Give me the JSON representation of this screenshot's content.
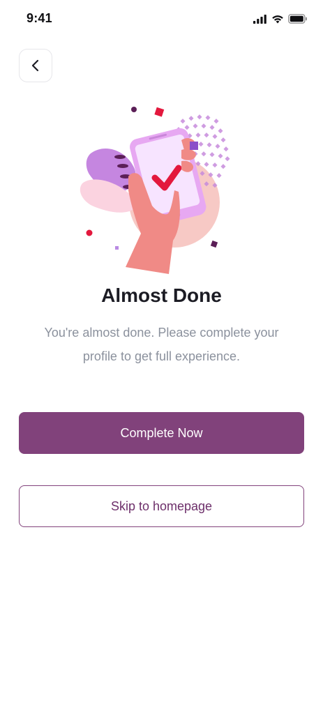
{
  "status_bar": {
    "time": "9:41",
    "icons": [
      "signal-icon",
      "wifi-icon",
      "battery-icon"
    ]
  },
  "header": {
    "back_icon": "chevron-left-icon"
  },
  "main": {
    "title": "Almost Done",
    "subtitle": "You're almost done. Please complete your profile to get full experience."
  },
  "actions": {
    "primary_label": "Complete Now",
    "secondary_label": "Skip to homepage"
  },
  "colors": {
    "primary": "#81427b",
    "text": "#1c1c24",
    "muted": "#8b919d"
  }
}
